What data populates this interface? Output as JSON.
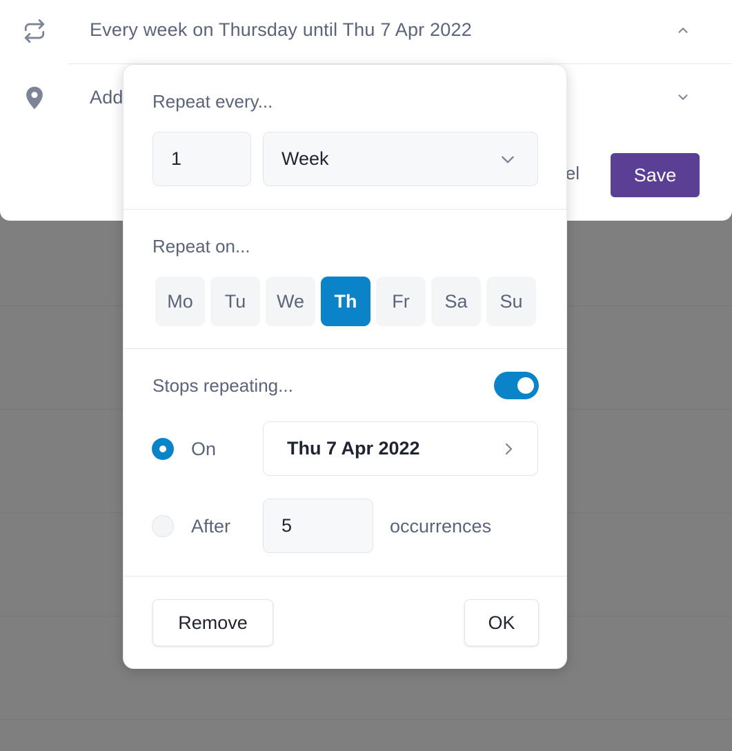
{
  "editor": {
    "recurrence_summary": "Every week on Thursday until Thu 7 Apr 2022",
    "location_placeholder": "Add",
    "cancel_label": "el",
    "save_label": "Save",
    "icons": {
      "repeat": "repeat-icon",
      "location": "location-pin-icon",
      "recurrence_chevron": "chevron-up-icon",
      "location_chevron": "chevron-down-icon"
    }
  },
  "popover": {
    "repeat_every": {
      "label": "Repeat every...",
      "interval": "1",
      "unit": "Week"
    },
    "repeat_on": {
      "label": "Repeat on...",
      "days": [
        "Mo",
        "Tu",
        "We",
        "Th",
        "Fr",
        "Sa",
        "Su"
      ],
      "selected": "Th"
    },
    "stops": {
      "label": "Stops repeating...",
      "enabled": true,
      "on_label": "On",
      "on_date": "Thu 7 Apr 2022",
      "after_label": "After",
      "after_count": "5",
      "occurrences_label": "occurrences",
      "selected_option": "On"
    },
    "actions": {
      "remove_label": "Remove",
      "ok_label": "OK"
    }
  },
  "colors": {
    "accent": "#0a83c9",
    "save_button": "#5b3f95",
    "overlay": "#7f7f7f",
    "muted_text": "#5b6478"
  }
}
